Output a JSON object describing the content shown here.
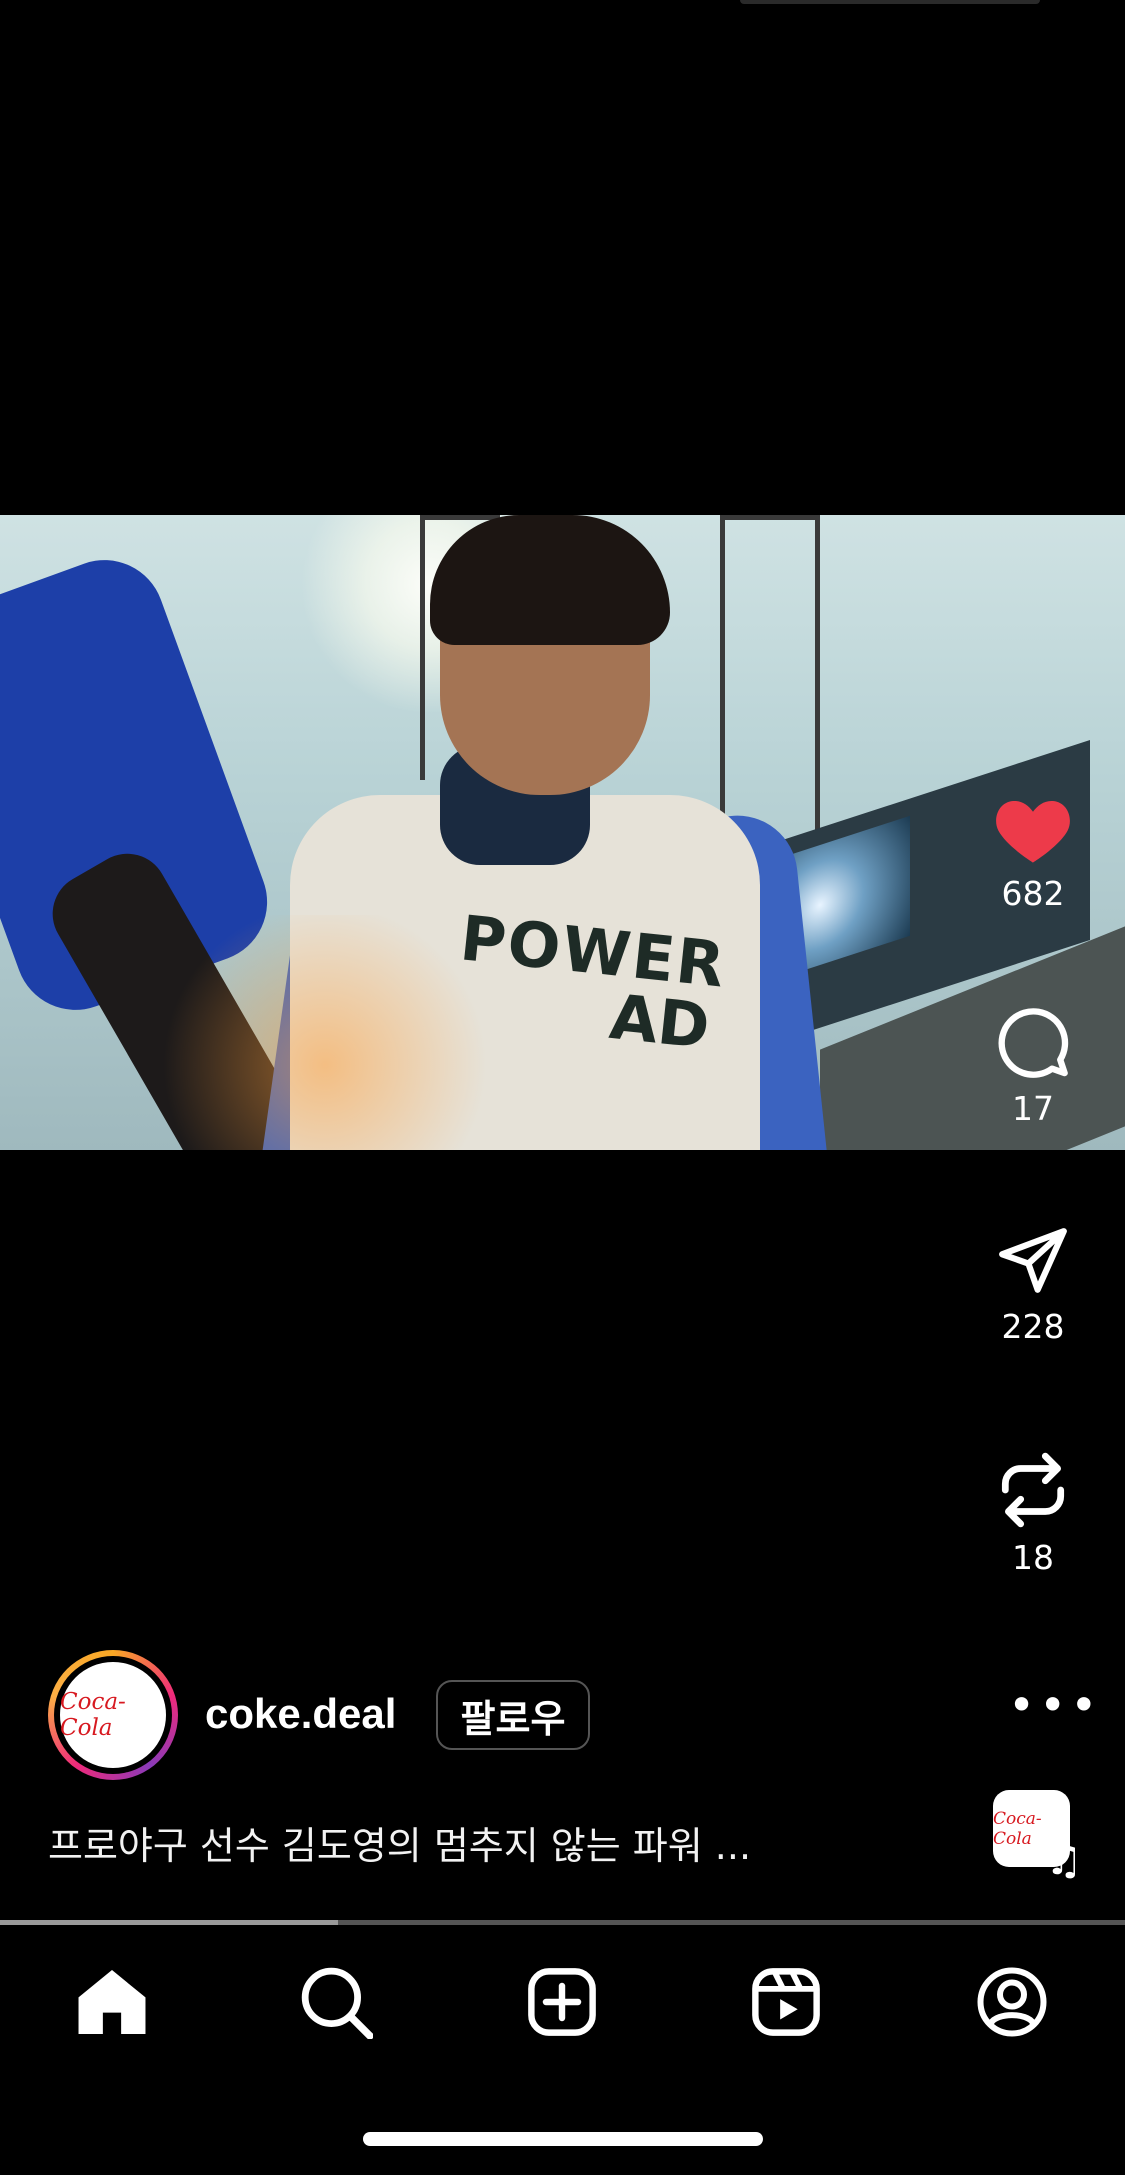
{
  "post": {
    "likes": "682",
    "comments": "17",
    "shares": "228",
    "reposts": "18",
    "username": "coke.deal",
    "follow_label": "팔로우",
    "caption": "프로야구 선수 김도영의 멈추지 않는 파워 ...",
    "avatar_logo_text": "Coca-Cola",
    "audio_logo_text": "Coca-Cola",
    "jersey_text_line1": "POWER",
    "jersey_text_line2": "AD"
  },
  "playback": {
    "progress_fraction": 0.3
  },
  "colors": {
    "like": "#ed3a4a",
    "background": "#000000"
  },
  "icons": {
    "actions": [
      "heart-icon",
      "comment-icon",
      "send-icon",
      "repost-icon",
      "more-icon",
      "music-note-icon"
    ],
    "nav": [
      "home-icon",
      "search-icon",
      "create-icon",
      "reels-icon",
      "profile-icon"
    ]
  }
}
